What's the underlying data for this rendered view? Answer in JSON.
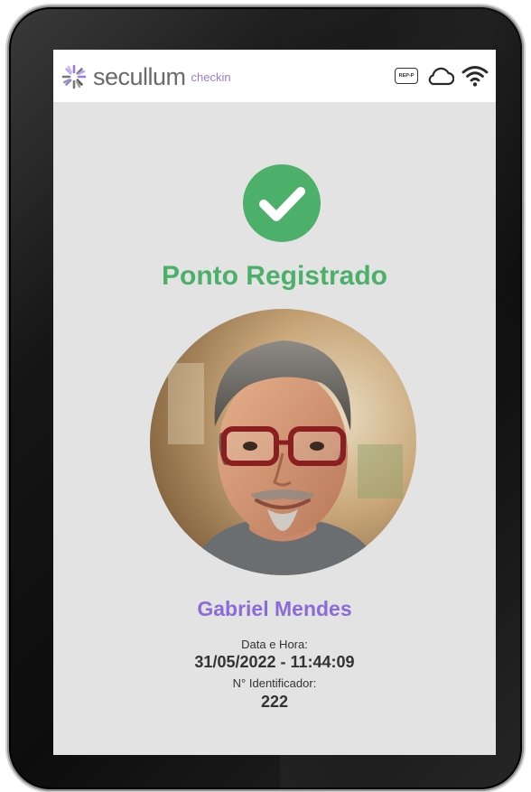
{
  "app": {
    "brand": "secullum",
    "product": "checkin"
  },
  "status_bar": {
    "rep_badge": "REP-P",
    "icons": [
      "cloud-icon",
      "wifi-icon"
    ]
  },
  "status": {
    "icon": "check-circle-icon",
    "title": "Ponto Registrado",
    "color": "#4caf6a"
  },
  "employee": {
    "name": "Gabriel Mendes",
    "name_color": "#8b6cd6",
    "photo": "employee-photo"
  },
  "details": {
    "datetime_label": "Data e Hora:",
    "datetime_value": "31/05/2022 - 11:44:09",
    "id_label": "N° Identificador:",
    "id_value": "222"
  }
}
